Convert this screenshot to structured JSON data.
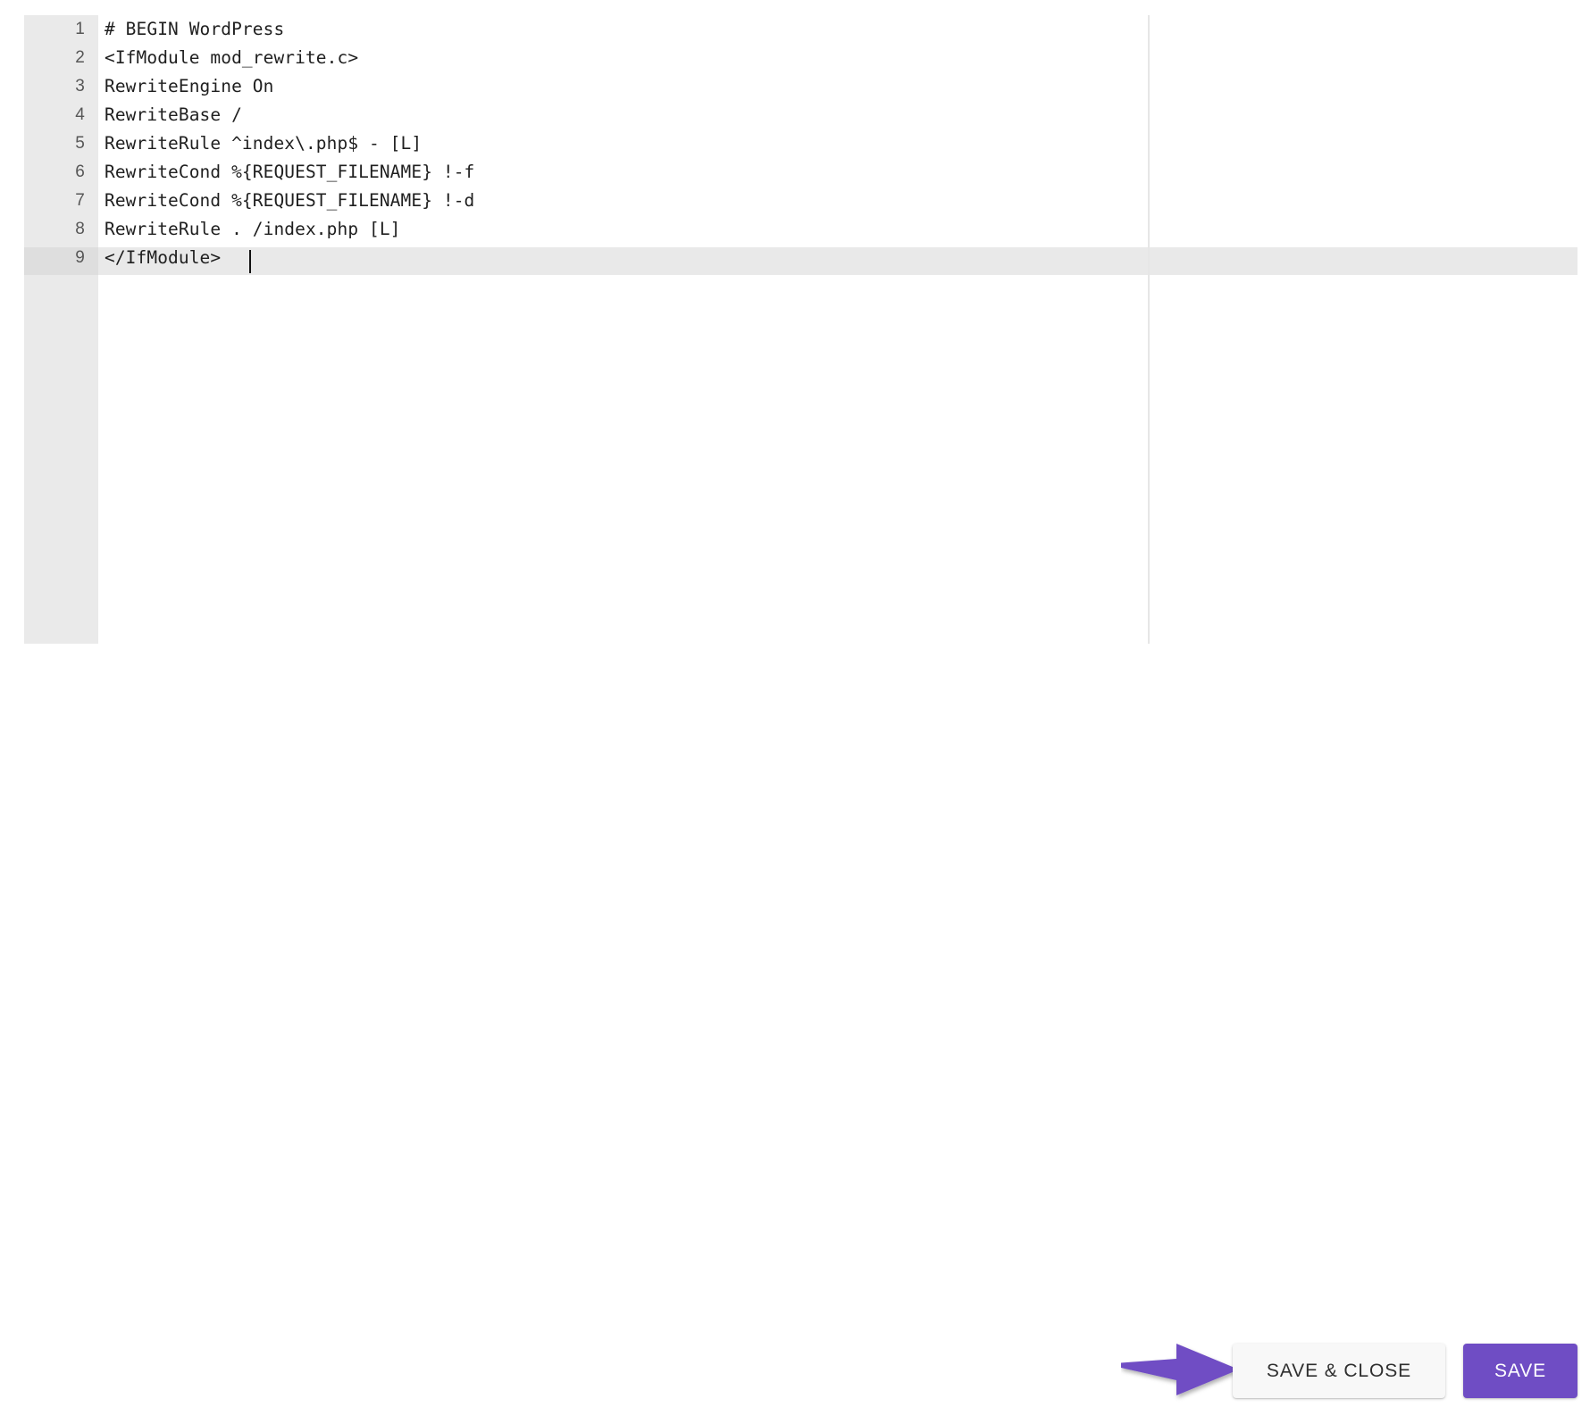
{
  "editor": {
    "language_hint": "apache-htaccess",
    "active_line": 9,
    "cursor_column": 12,
    "gutter_color": "#eaeaea",
    "active_line_color": "#e9e9e9",
    "ruler_column": 80,
    "lines": [
      {
        "number": "1",
        "text": "# BEGIN WordPress"
      },
      {
        "number": "2",
        "text": "<IfModule mod_rewrite.c>"
      },
      {
        "number": "3",
        "text": "RewriteEngine On"
      },
      {
        "number": "4",
        "text": "RewriteBase /"
      },
      {
        "number": "5",
        "text": "RewriteRule ^index\\.php$ - [L]"
      },
      {
        "number": "6",
        "text": "RewriteCond %{REQUEST_FILENAME} !-f"
      },
      {
        "number": "7",
        "text": "RewriteCond %{REQUEST_FILENAME} !-d"
      },
      {
        "number": "8",
        "text": "RewriteRule . /index.php [L]"
      },
      {
        "number": "9",
        "text": "</IfModule>"
      }
    ]
  },
  "actions": {
    "save_close_label": "SAVE & CLOSE",
    "save_label": "SAVE",
    "save_button_color": "#6f4dc4",
    "save_close_button_color": "#f8f8f8"
  },
  "annotation": {
    "arrow_color": "#6f4dc4",
    "points_to": "SAVE & CLOSE"
  }
}
